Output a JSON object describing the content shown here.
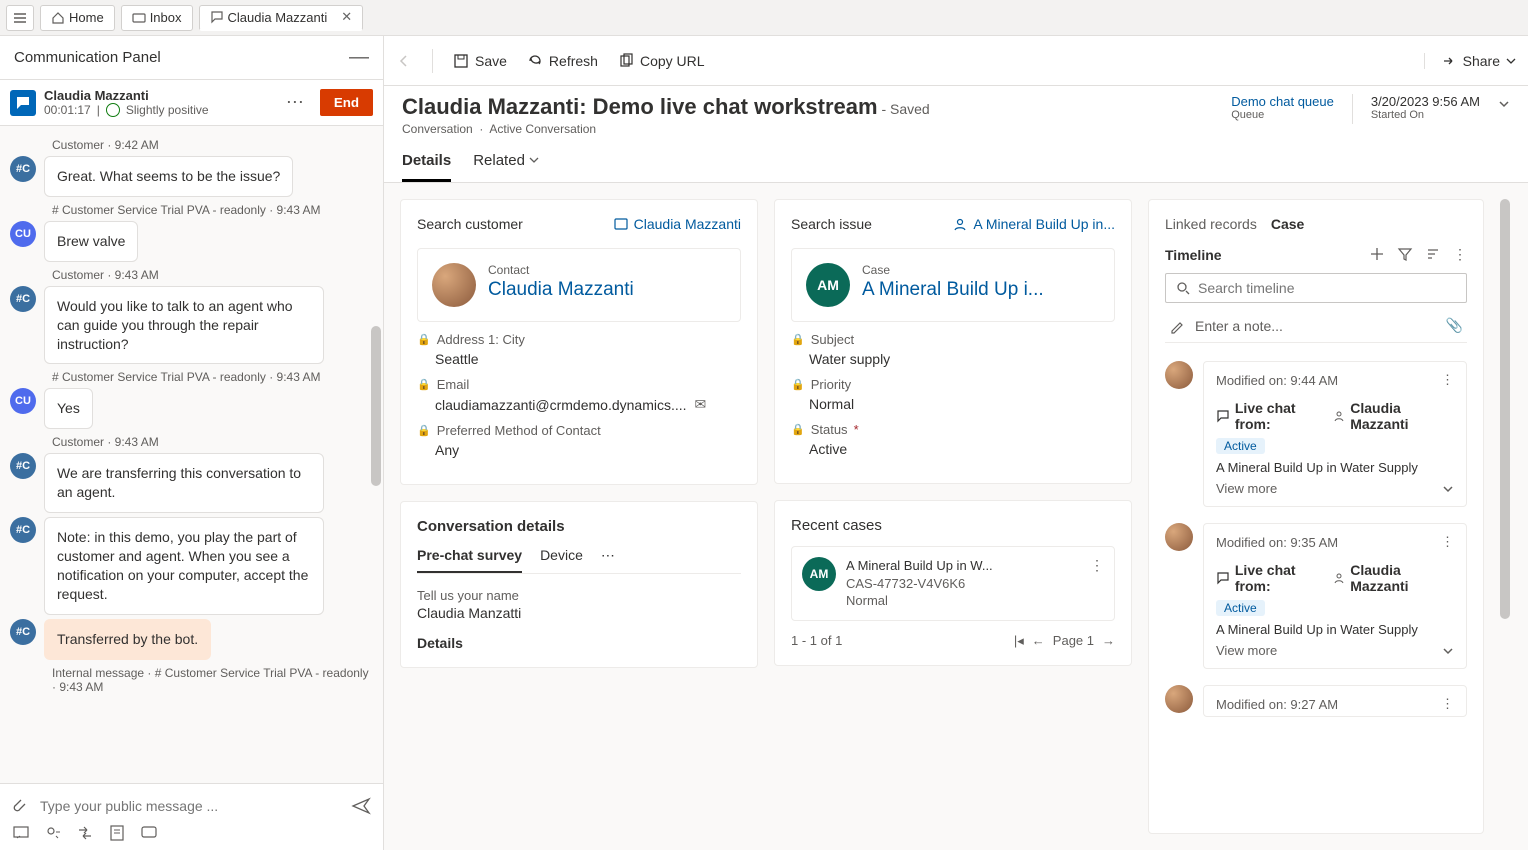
{
  "topbar": {
    "home": "Home",
    "inbox": "Inbox",
    "tab_name": "Claudia Mazzanti"
  },
  "comm_panel": {
    "title": "Communication Panel",
    "session_name": "Claudia Mazzanti",
    "timer": "00:01:17",
    "sentiment": "Slightly positive",
    "end": "End",
    "messages": [
      {
        "meta": "Customer · 9:42 AM",
        "avatar": "#C",
        "text": "Great. What seems to be the issue?",
        "cls": ""
      },
      {
        "meta": "# Customer Service Trial PVA - readonly · 9:43 AM",
        "avatar": "CU",
        "text": "Brew valve",
        "cls": "cu"
      },
      {
        "meta": "Customer · 9:43 AM",
        "avatar": "#C",
        "text": "Would you like to talk to an agent who can guide you through the repair instruction?",
        "cls": ""
      },
      {
        "meta": "# Customer Service Trial PVA - readonly · 9:43 AM",
        "avatar": "CU",
        "text": "Yes",
        "cls": "cu"
      },
      {
        "meta": "Customer · 9:43 AM",
        "avatar": "#C",
        "text": "We are transferring this conversation to an agent.",
        "cls": ""
      },
      {
        "meta": "",
        "avatar": "#C",
        "text": "Note: in this demo, you play the part of customer and agent. When you see a notification on your computer, accept the request.",
        "cls": ""
      },
      {
        "meta": "",
        "avatar": "#C",
        "text": "Transferred by the bot.",
        "cls": "transfer"
      },
      {
        "meta": "Internal message · # Customer Service Trial PVA - readonly · 9:43 AM",
        "avatar": "",
        "text": "",
        "cls": "meta-only"
      }
    ],
    "compose_placeholder": "Type your public message ..."
  },
  "cmd": {
    "save": "Save",
    "refresh": "Refresh",
    "copy": "Copy URL",
    "share": "Share"
  },
  "header": {
    "title": "Claudia Mazzanti: Demo live chat workstream",
    "saved": "- Saved",
    "sub1": "Conversation",
    "sub2": "Active Conversation",
    "queue_v": "Demo chat queue",
    "queue_l": "Queue",
    "started_v": "3/20/2023 9:56 AM",
    "started_l": "Started On"
  },
  "tabs": {
    "details": "Details",
    "related": "Related"
  },
  "customer_card": {
    "search": "Search customer",
    "link": "Claudia Mazzanti",
    "contact_lbl": "Contact",
    "contact_name": "Claudia Mazzanti",
    "addr_lbl": "Address 1: City",
    "addr_val": "Seattle",
    "email_lbl": "Email",
    "email_val": "claudiamazzanti@crmdemo.dynamics....",
    "pmc_lbl": "Preferred Method of Contact",
    "pmc_val": "Any"
  },
  "issue_card": {
    "search": "Search issue",
    "link": "A Mineral Build Up in...",
    "case_lbl": "Case",
    "case_name": "A Mineral Build Up i...",
    "avatar": "AM",
    "subj_lbl": "Subject",
    "subj_val": "Water supply",
    "prio_lbl": "Priority",
    "prio_val": "Normal",
    "status_lbl": "Status",
    "status_val": "Active"
  },
  "conv_details": {
    "title": "Conversation details",
    "tab1": "Pre-chat survey",
    "tab2": "Device",
    "q1": "Tell us your name",
    "a1": "Claudia Manzatti",
    "details": "Details"
  },
  "recent": {
    "title": "Recent cases",
    "case_title": "A Mineral Build Up in W...",
    "case_num": "CAS-47732-V4V6K6",
    "case_prio": "Normal",
    "avatar": "AM",
    "pager_info": "1 - 1 of 1",
    "pager_page": "Page 1"
  },
  "linked": {
    "label": "Linked records",
    "current": "Case",
    "timeline_title": "Timeline",
    "search_placeholder": "Search timeline",
    "note_placeholder": "Enter a note...",
    "items": [
      {
        "time": "Modified on: 9:44 AM",
        "title_prefix": "Live chat from:",
        "person": "Claudia Mazzanti",
        "badge": "Active",
        "desc": "A Mineral Build Up in Water Supply",
        "viewmore": "View more"
      },
      {
        "time": "Modified on: 9:35 AM",
        "title_prefix": "Live chat from:",
        "person": "Claudia Mazzanti",
        "badge": "Active",
        "desc": "A Mineral Build Up in Water Supply",
        "viewmore": "View more"
      },
      {
        "time": "Modified on: 9:27 AM"
      }
    ]
  }
}
